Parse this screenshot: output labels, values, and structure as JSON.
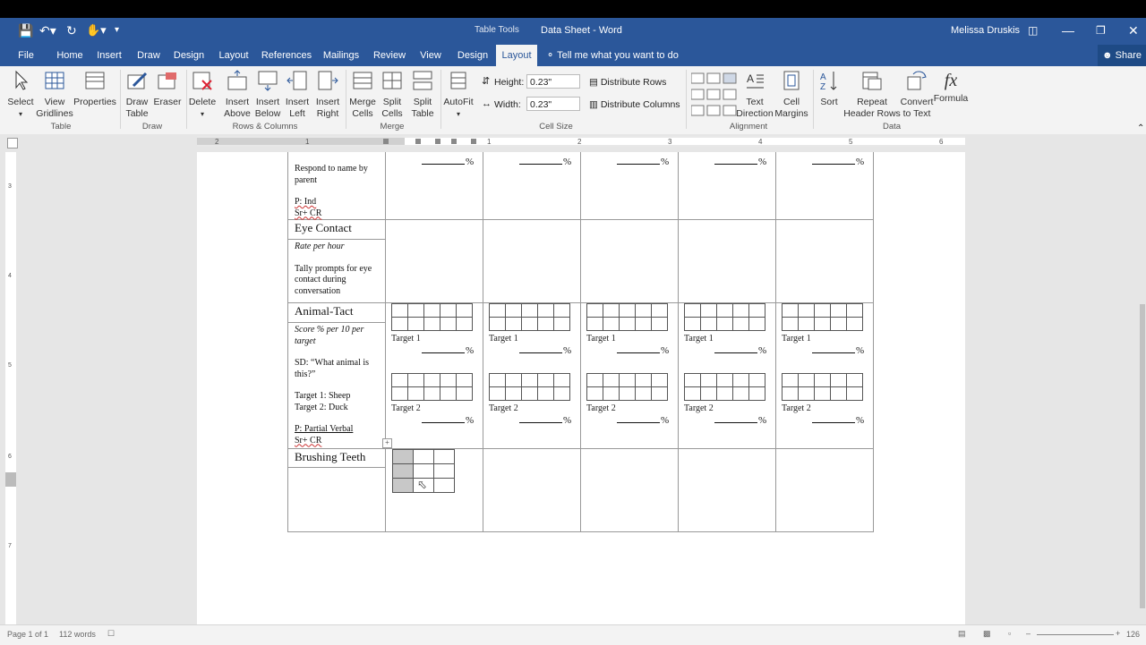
{
  "window": {
    "title": "Data Sheet - Word",
    "context_tab": "Table Tools",
    "user": "Melissa Druskis",
    "share": "Share"
  },
  "tabs": [
    "File",
    "Home",
    "Insert",
    "Draw",
    "Design",
    "Layout",
    "References",
    "Mailings",
    "Review",
    "View",
    "Design",
    "Layout"
  ],
  "tell_me": "Tell me what you want to do",
  "ribbon": {
    "select": "Select",
    "view_gridlines": [
      "View",
      "Gridlines"
    ],
    "properties": "Properties",
    "draw_table": [
      "Draw",
      "Table"
    ],
    "eraser": "Eraser",
    "delete": "Delete",
    "insert_above": [
      "Insert",
      "Above"
    ],
    "insert_below": [
      "Insert",
      "Below"
    ],
    "insert_left": [
      "Insert",
      "Left"
    ],
    "insert_right": [
      "Insert",
      "Right"
    ],
    "merge_cells": [
      "Merge",
      "Cells"
    ],
    "split_cells": [
      "Split",
      "Cells"
    ],
    "split_table": [
      "Split",
      "Table"
    ],
    "autofit": "AutoFit",
    "height_label": "Height:",
    "height_value": "0.23\"",
    "width_label": "Width:",
    "width_value": "0.23\"",
    "distribute_rows": "Distribute Rows",
    "distribute_columns": "Distribute Columns",
    "text_direction": [
      "Text",
      "Direction"
    ],
    "cell_margins": [
      "Cell",
      "Margins"
    ],
    "sort": "Sort",
    "repeat_header": [
      "Repeat",
      "Header Rows"
    ],
    "convert_text": [
      "Convert",
      "to Text"
    ],
    "formula": "Formula",
    "groups": {
      "table": "Table",
      "draw": "Draw",
      "rows_columns": "Rows & Columns",
      "merge": "Merge",
      "cell_size": "Cell Size",
      "alignment": "Alignment",
      "data": "Data"
    }
  },
  "ruler_numbers": [
    "2",
    "1",
    "1",
    "2",
    "3",
    "4",
    "5",
    "6"
  ],
  "doc": {
    "row1": {
      "line1": "Respond to name by",
      "line2": "parent",
      "p1": "P: Ind",
      "p2": "Sr+ CR"
    },
    "row2": {
      "heading": "Eye Contact",
      "sub": "Rate per hour",
      "t1": "Tally prompts for eye",
      "t2": "contact during",
      "t3": "conversation"
    },
    "row3": {
      "heading": "Animal-Tact",
      "sub1": "Score % per 10 per",
      "sub2": "target",
      "sd1": "SD: “What animal is",
      "sd2": "this?”",
      "tg1": "Target 1: Sheep",
      "tg2": "Target 2: Duck",
      "p1": "P: Partial Verbal",
      "p2": "Sr+ CR"
    },
    "row4": {
      "heading": "Brushing Teeth"
    },
    "target1": "Target 1",
    "target2": "Target 2",
    "percent": "%"
  },
  "status": {
    "page": "Page 1 of 1",
    "words": "112 words",
    "zoom": "126"
  }
}
